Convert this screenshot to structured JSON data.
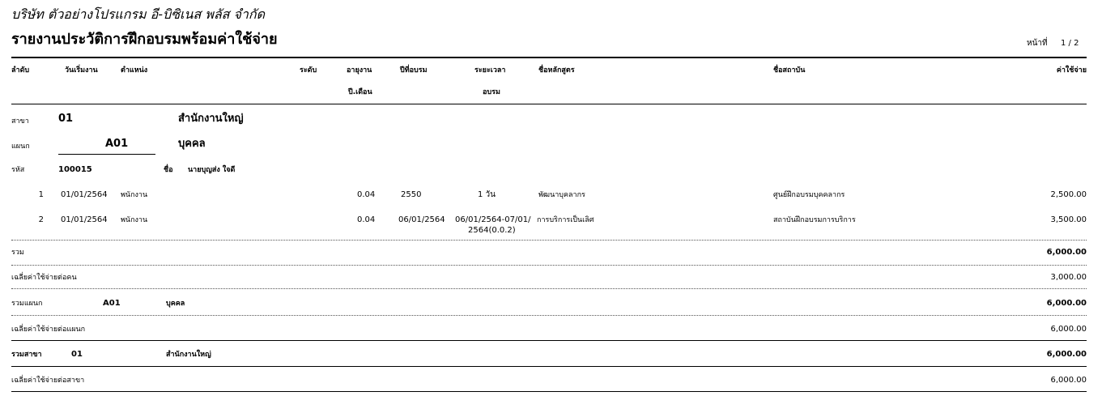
{
  "company": "บริษัท ตัวอย่างโปรแกรม อี-บิซิเนส พลัส จำกัด",
  "report_title": "รายงานประวัติการฝึกอบรมพร้อมค่าใช้จ่าย",
  "page": {
    "label": "หน้าที่",
    "number": "1 / 2"
  },
  "columns": {
    "seq": "ลำดับ",
    "start_date": "วันเริ่มงาน",
    "position": "ตำแหน่ง",
    "level": "ระดับ",
    "tenure": "อายุงาน",
    "tenure_unit": "ปี.เดือน",
    "training_year": "ปีที่อบรม",
    "duration": "ระยะเวลา",
    "duration_sub": "อบรม",
    "course": "ชื่อหลักสูตร",
    "institute": "ชื่อสถาบัน",
    "expense": "ค่าใช้จ่าย"
  },
  "branch": {
    "label": "สาขา",
    "code": "01",
    "name": "สำนักงานใหญ่"
  },
  "department": {
    "label": "แผนก",
    "code": "A01",
    "name": "บุคคล"
  },
  "employee": {
    "id_label": "รหัส",
    "id": "100015",
    "name_label": "ชื่อ",
    "name": "นายบุญส่ง ใจดี"
  },
  "rows": [
    {
      "seq": "1",
      "start_date": "01/01/2564",
      "position": "พนักงาน",
      "tenure": "0.04",
      "training_year": "2550",
      "duration": "1 วัน",
      "duration_line2": "",
      "course": "พัฒนาบุคลากร",
      "institute": "ศูนย์ฝึกอบรมบุคคลากร",
      "expense": "2,500.00"
    },
    {
      "seq": "2",
      "start_date": "01/01/2564",
      "position": "พนักงาน",
      "tenure": "0.04",
      "training_year": "06/01/2564",
      "duration": "06/01/2564-07/01/",
      "duration_line2": "2564(0.0.2)",
      "course": "การบริการเป็นเลิศ",
      "institute": "สถาบันฝึกอบรมการบริการ",
      "expense": "3,500.00"
    }
  ],
  "summary": {
    "total_label": "รวม",
    "total_value": "6,000.00",
    "avg_person_label": "เฉลี่ยค่าใช้จ่ายต่อคน",
    "avg_person_value": "3,000.00",
    "dept_total_label": "รวมแผนก",
    "dept_code": "A01",
    "dept_name": "บุคคล",
    "dept_total_value": "6,000.00",
    "avg_dept_label": "เฉลี่ยค่าใช้จ่ายต่อแผนก",
    "avg_dept_value": "6,000.00",
    "branch_total_label": "รวมสาขา",
    "branch_code": "01",
    "branch_name": "สำนักงานใหญ่",
    "branch_total_value": "6,000.00",
    "avg_branch_label": "เฉลี่ยค่าใช้จ่ายต่อสาขา",
    "avg_branch_value": "6,000.00"
  }
}
